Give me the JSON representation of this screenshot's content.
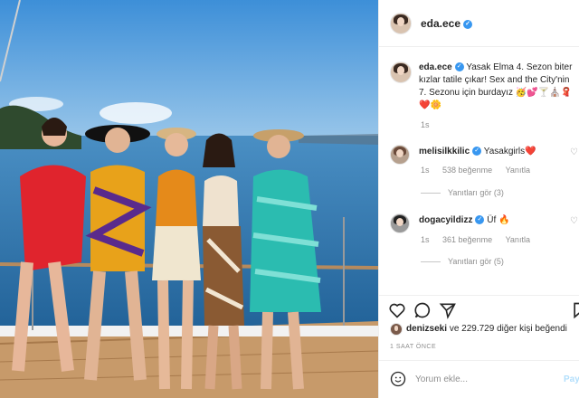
{
  "post": {
    "author": "eda.ece",
    "caption_user": "eda.ece",
    "caption_text": "Yasak Elma 4. Sezon biter kızlar tatile çıkar! Sex and the City'nin 7. Sezonu için burdayız 🥳💕🍸⛪🧣❤️🌼",
    "caption_age": "1s",
    "likes_user": "denizseki",
    "likes_rest": "ve 229.729 diğer kişi beğendi",
    "timestamp": "1 SAAT ÖNCE",
    "comment_placeholder": "Yorum ekle...",
    "post_label": "Payl"
  },
  "comments": [
    {
      "user": "melisilkkilic",
      "text": "Yasakgirls❤️",
      "age": "1s",
      "likes": "538 beğenme",
      "reply": "Yanıtla",
      "view_replies": "Yanıtları gör (3)"
    },
    {
      "user": "dogacyildizz",
      "text": "Üf 🔥",
      "age": "1s",
      "likes": "361 beğenme",
      "reply": "Yanıtla",
      "view_replies": "Yanıtları gör (5)"
    }
  ],
  "icons": [
    "verified-badge-icon",
    "heart-icon",
    "comment-icon",
    "share-icon",
    "bookmark-icon",
    "emoji-icon"
  ],
  "colors": {
    "verified": "#3897f0",
    "muted": "#8e8e8e",
    "post_button": "#b2dffc",
    "sea": "#2f7fb8"
  }
}
